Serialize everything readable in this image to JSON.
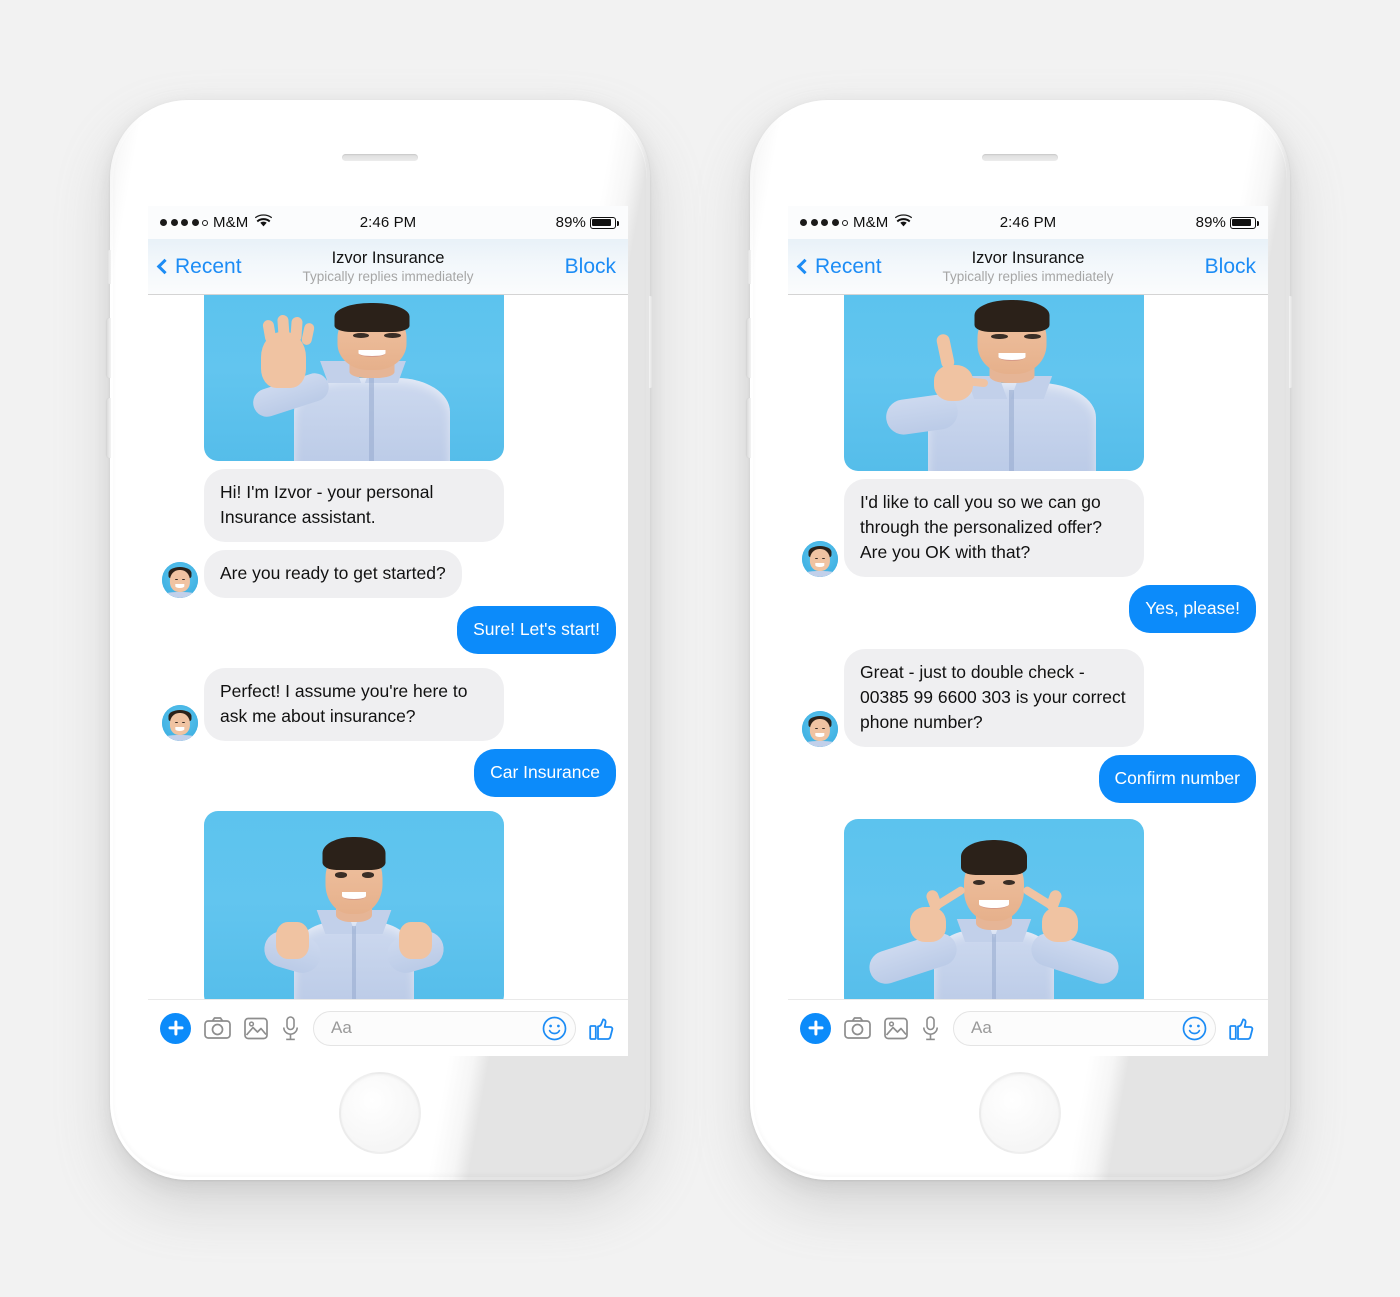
{
  "page": {
    "background_color": "#f2f2f2",
    "device_count": 2
  },
  "status_bar": {
    "carrier": "M&M",
    "signal_dots_filled": 4,
    "signal_dots_total": 5,
    "wifi_icon": "wifi-icon",
    "time": "2:46 PM",
    "battery_percent": "89%",
    "battery_level": 89
  },
  "nav": {
    "back_label": "Recent",
    "back_icon": "chevron-left-icon",
    "title": "Izvor Insurance",
    "subtitle": "Typically replies immediately",
    "action_label": "Block"
  },
  "composer": {
    "plus_icon": "plus-icon",
    "camera_icon": "camera-icon",
    "gallery_icon": "photo-icon",
    "mic_icon": "microphone-icon",
    "input_placeholder": "Aa",
    "emoji_icon": "smiley-icon",
    "like_icon": "thumbs-up-icon"
  },
  "colors": {
    "accent_blue": "#0c8bfa",
    "nav_blue": "#1c8cf5",
    "incoming_bubble": "#efeff1",
    "outgoing_bubble": "#0c8bfa",
    "photo_bg_blue": "#5cc3ee",
    "page_bg": "#f2f2f2"
  },
  "phones": [
    {
      "id": "phone-left",
      "messages": [
        {
          "kind": "image",
          "side": "in",
          "alt": "man-waving-photo",
          "avatar": false,
          "variant": "wave",
          "position": "top"
        },
        {
          "kind": "text",
          "side": "in",
          "text": "Hi! I'm Izvor - your personal Insurance assistant.",
          "avatar": false
        },
        {
          "kind": "text",
          "side": "in",
          "text": "Are you ready to get started?",
          "avatar": true
        },
        {
          "kind": "text",
          "side": "out",
          "text": "Sure! Let's start!"
        },
        {
          "kind": "text",
          "side": "in",
          "text": "Perfect! I assume you're here to ask me about insurance?",
          "avatar": true
        },
        {
          "kind": "text",
          "side": "out",
          "text": "Car Insurance"
        },
        {
          "kind": "image",
          "side": "in",
          "alt": "man-fists-celebrating-photo",
          "avatar": false,
          "variant": "fists",
          "position": "bottom"
        }
      ]
    },
    {
      "id": "phone-right",
      "messages": [
        {
          "kind": "image",
          "side": "in",
          "alt": "man-call-me-gesture-photo",
          "avatar": false,
          "variant": "callme",
          "position": "top"
        },
        {
          "kind": "text",
          "side": "in",
          "text": "I'd like to call you so we can go through the personalized offer? Are you OK with that?",
          "avatar": true
        },
        {
          "kind": "text",
          "side": "out",
          "text": "Yes, please!"
        },
        {
          "kind": "text",
          "side": "in",
          "text": "Great - just to double check - 00385 99 6600 303 is your correct phone number?",
          "avatar": true
        },
        {
          "kind": "text",
          "side": "out",
          "text": "Confirm number"
        },
        {
          "kind": "image",
          "side": "in",
          "alt": "man-pointing-at-self-photo",
          "avatar": false,
          "variant": "point",
          "position": "bottom"
        }
      ]
    }
  ]
}
